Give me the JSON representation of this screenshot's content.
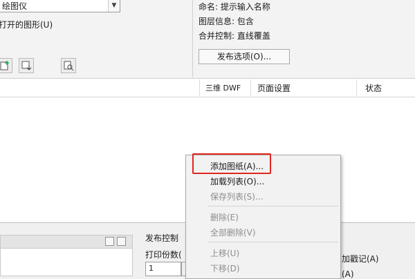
{
  "top": {
    "plotter_combo_value": "绘图仪",
    "open_drawings_label": "打开的图形(U)",
    "info": {
      "naming": "命名: 提示输入名称",
      "layer_info": "图层信息: 包含",
      "merge_control": "合并控制: 直线覆盖"
    },
    "publish_options_button": "发布选项(O)..."
  },
  "list_columns": [
    "三维 DWF",
    "页面设置",
    "状态"
  ],
  "context_menu": {
    "items": [
      {
        "label": "添加图纸(A)...",
        "enabled": true,
        "highlighted": true
      },
      {
        "label": "加载列表(O)...",
        "enabled": true
      },
      {
        "label": "保存列表(S)...",
        "enabled": false
      },
      {
        "label": "删除(E)",
        "enabled": false
      },
      {
        "label": "全部删除(V)",
        "enabled": false
      },
      {
        "label": "上移(U)",
        "enabled": false
      },
      {
        "label": "下移(D)",
        "enabled": false
      }
    ],
    "highlight_color": "#e0251f"
  },
  "bottom": {
    "publish_control_label": "发布控制",
    "copies_label": "打印份数(",
    "copies_value": "1",
    "right_label": "加戳记(A)",
    "right_label2": "(A)"
  }
}
